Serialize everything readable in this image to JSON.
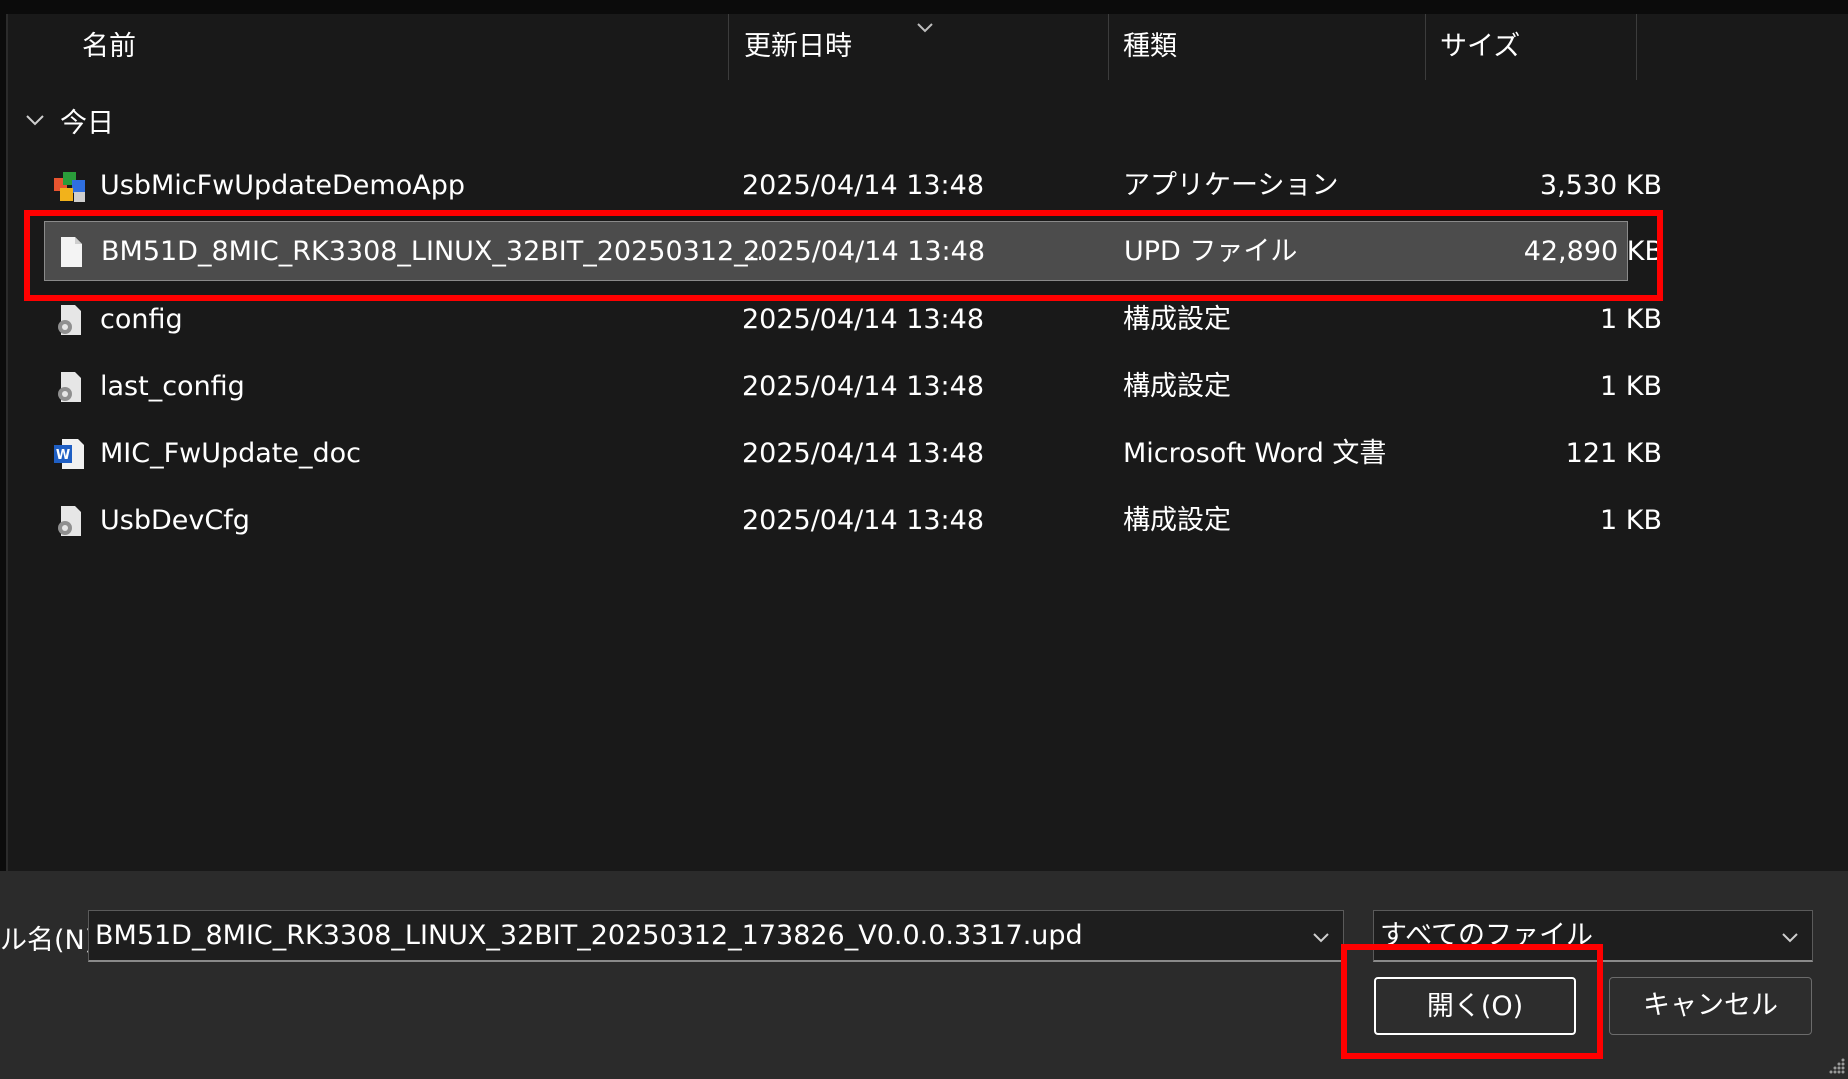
{
  "columns": {
    "name": "名前",
    "modified": "更新日時",
    "type": "種類",
    "size": "サイズ"
  },
  "group": {
    "label": "今日"
  },
  "files": [
    {
      "name": "UsbMicFwUpdateDemoApp",
      "modified": "2025/04/14 13:48",
      "type": "アプリケーション",
      "size": "3,530 KB",
      "icon": "application-icon",
      "selected": false
    },
    {
      "name": "BM51D_8MIC_RK3308_LINUX_32BIT_20250312_...",
      "modified": "2025/04/14 13:48",
      "type": "UPD ファイル",
      "size": "42,890 KB",
      "icon": "blank-file-icon",
      "selected": true
    },
    {
      "name": "config",
      "modified": "2025/04/14 13:48",
      "type": "構成設定",
      "size": "1 KB",
      "icon": "config-file-icon",
      "selected": false
    },
    {
      "name": "last_config",
      "modified": "2025/04/14 13:48",
      "type": "構成設定",
      "size": "1 KB",
      "icon": "config-file-icon",
      "selected": false
    },
    {
      "name": "MIC_FwUpdate_doc",
      "modified": "2025/04/14 13:48",
      "type": "Microsoft Word 文書",
      "size": "121 KB",
      "icon": "word-document-icon",
      "selected": false
    },
    {
      "name": "UsbDevCfg",
      "modified": "2025/04/14 13:48",
      "type": "構成設定",
      "size": "1 KB",
      "icon": "config-file-icon",
      "selected": false
    }
  ],
  "filename_field": {
    "label": "ル名(N):",
    "value": "BM51D_8MIC_RK3308_LINUX_32BIT_20250312_173826_V0.0.0.3317.upd"
  },
  "file_type_filter": {
    "selected": "すべてのファイル"
  },
  "buttons": {
    "open": "開く(O)",
    "cancel": "キャンセル"
  },
  "colors": {
    "annotation": "#ff0000",
    "selected_row": "#4c4c4c",
    "list_background": "#191919",
    "bottom_background": "#2b2b2b"
  }
}
